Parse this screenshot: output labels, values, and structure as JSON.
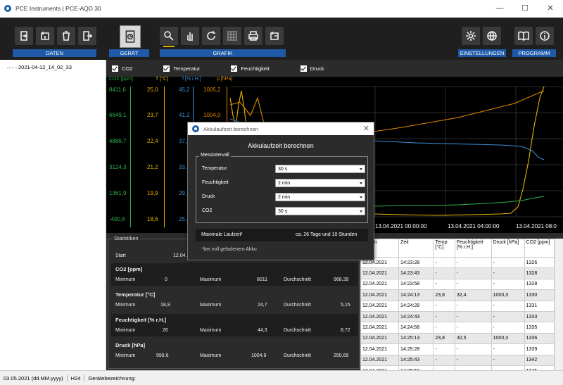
{
  "window": {
    "title": "PCE Instruments | PCE-AQD 30",
    "min": "—",
    "max": "☐",
    "close": "✕"
  },
  "toolbar": {
    "groups": {
      "daten": "DATEN",
      "geraet": "GERÄT",
      "grafik": "GRAFIK",
      "einstellungen": "EINSTELLUNGEN",
      "programm": "PROGRAMM"
    }
  },
  "tree": {
    "items": [
      "2021-04-12_14_02_33"
    ]
  },
  "checks": {
    "co2": "CO2",
    "temperatur": "Temperatur",
    "feuchtigkeit": "Feuchtigkeit",
    "druck": "Druck"
  },
  "axes": {
    "co2": {
      "header": "CO2 [ppm]",
      "ticks": [
        "8411,6",
        "6649,1",
        "4886,7",
        "3124,3",
        "1361,9",
        "-400,6"
      ],
      "color": "#2bb24c"
    },
    "temp": {
      "header": "T [°C]",
      "ticks": [
        "25,0",
        "23,7",
        "22,4",
        "21,2",
        "19,9",
        "18,6"
      ],
      "color": "#e6b400"
    },
    "feuchte": {
      "header": "f [% r.H.]",
      "ticks": [
        "45,2",
        "41,2",
        "37,2",
        "33,1",
        "29,1",
        "25,1"
      ],
      "color": "#3a8fd6"
    },
    "druck": {
      "header": "p [hPa]",
      "ticks": [
        "1005,2",
        "1004,0"
      ],
      "color": "#e08a00"
    }
  },
  "chart_data": {
    "type": "line",
    "xticks": [
      "13.04.2021 00:00:00",
      "13.04.2021 04:00:00",
      "13.04.2021 08:0"
    ]
  },
  "stats": {
    "title": "Statistiken",
    "start_label": "Start",
    "start_value": "12.04.2",
    "min_label": "Minimum",
    "max_label": "Maximum",
    "avg_label": "Durchschnitt",
    "groups": [
      {
        "name": "CO2 [ppm]",
        "min": "0",
        "max": "8011",
        "avg": "968,39"
      },
      {
        "name": "Temperatur [°C]",
        "min": "18,9",
        "max": "24,7",
        "avg": "5,15"
      },
      {
        "name": "Feuchtigkeit [% r.H.]",
        "min": "26",
        "max": "44,3",
        "avg": "8,72"
      },
      {
        "name": "Druck [hPa]",
        "min": "999,6",
        "max": "1004,9",
        "avg": "250,69"
      }
    ]
  },
  "table": {
    "headers": [
      "Datum",
      "Zeit",
      "Temp [°C]",
      "Feuchtigkeit [% r.H.]",
      "Druck [hPa]",
      "CO2 [ppm]"
    ],
    "rows": [
      [
        "12.04.2021",
        "14:23:28",
        "-",
        "-",
        "-",
        "1326"
      ],
      [
        "12.04.2021",
        "14:23:43",
        "-",
        "-",
        "-",
        "1328"
      ],
      [
        "12.04.2021",
        "14:23:58",
        "-",
        "-",
        "-",
        "1328"
      ],
      [
        "12.04.2021",
        "14:24:13",
        "23,8",
        "32,4",
        "1000,3",
        "1330"
      ],
      [
        "12.04.2021",
        "14:24:28",
        "-",
        "-",
        "-",
        "1331"
      ],
      [
        "12.04.2021",
        "14:24:43",
        "-",
        "-",
        "-",
        "1333"
      ],
      [
        "12.04.2021",
        "14:24:58",
        "-",
        "-",
        "-",
        "1335"
      ],
      [
        "12.04.2021",
        "14:25:13",
        "23,8",
        "32,5",
        "1000,3",
        "1336"
      ],
      [
        "12.04.2021",
        "14:25:28",
        "-",
        "-",
        "-",
        "1339"
      ],
      [
        "12.04.2021",
        "14:25:43",
        "-",
        "-",
        "-",
        "1342"
      ],
      [
        "12.04.2021",
        "14:25:58",
        "-",
        "-",
        "-",
        "1345"
      ]
    ]
  },
  "status": {
    "date": "03.05.2021 (dd.MM.yyyy)",
    "mode": "H24",
    "device": "Gerätebezeichnung:"
  },
  "dialog": {
    "title": "Akkulaufzeit berechnen",
    "heading": "Akkulaufzeit berechnen",
    "group": "Messintervall",
    "rows": [
      {
        "label": "Temperatur",
        "value": "30 s"
      },
      {
        "label": "Feuchtigkeit",
        "value": "2 min"
      },
      {
        "label": "Druck",
        "value": "2 min"
      },
      {
        "label": "CO2",
        "value": "30 s"
      }
    ],
    "result_label": "Maximale Laufzeit¹",
    "result_value": "ca. 26 Tage und 10 Stunden",
    "footnote": "¹bei voll geladenem Akku"
  }
}
